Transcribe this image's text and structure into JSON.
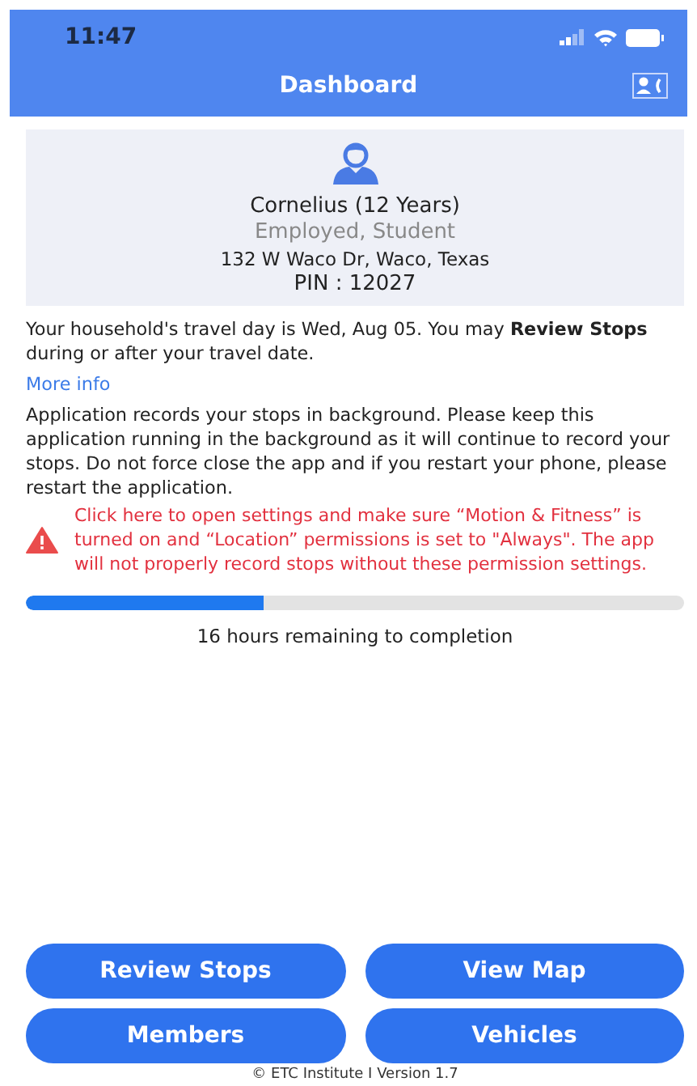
{
  "status_bar": {
    "time": "11:47"
  },
  "header": {
    "title": "Dashboard"
  },
  "profile": {
    "name": "Cornelius (12 Years)",
    "roles": "Employed, Student",
    "address": "132 W Waco Dr, Waco, Texas",
    "pin": "PIN : 12027"
  },
  "travel_note": "Your household's travel day is Wed, Aug 05. You may **Review Stops** during or after your travel date.",
  "more_info_link": "More info",
  "background_note": "Application records your stops in background. Please keep this application running in the background as it will continue to record your stops. Do not force close the app and if you restart your phone, please restart the application.",
  "warning": "Click here to open settings and make sure “Motion & Fitness” is turned on and “Location” permissions is set to \"Always\". The app will not properly record stops without these permission settings.",
  "progress": {
    "level": 0.36,
    "label": "16 hours remaining to completion"
  },
  "buttons": [
    {
      "label": "Review Stops"
    },
    {
      "label": "View Map"
    },
    {
      "label": "Members"
    },
    {
      "label": "Vehicles"
    }
  ],
  "footer": "© ETC Institute I Version 1.7"
}
